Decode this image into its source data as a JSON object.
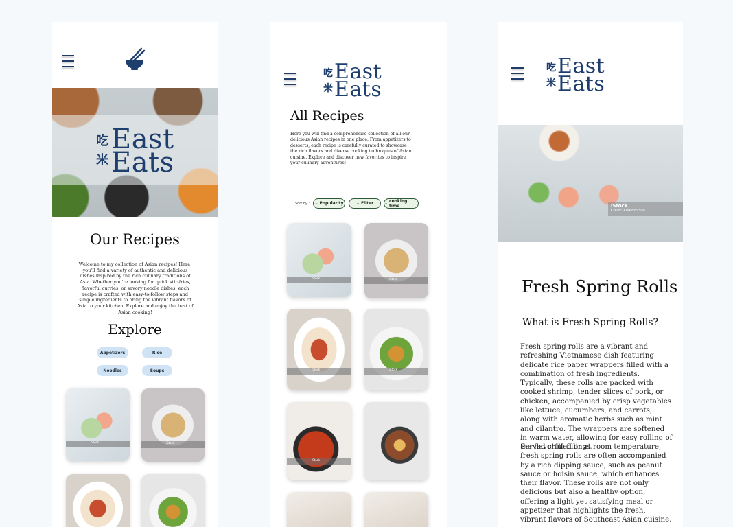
{
  "colors": {
    "brand_blue": "#1e3e6e",
    "chip_blue": "#cfe3f5",
    "sort_green_border": "#2f5a3a",
    "sort_green_bg": "#e9f4e6",
    "page_bg": "#f6f9fc"
  },
  "brand": {
    "name_line1": "East",
    "name_line2": "Eats",
    "char_top": "吃",
    "char_bottom": "米"
  },
  "screen1": {
    "title": "Our Recipes",
    "intro": "Welcome to my collection of Asian recipes! Here, you'll find a variety of authentic and delicious dishes inspired by the rich culinary traditions of Asia. Whether you're looking for quick stir-fries, flavorful curries, or savory noodle dishes, each recipe is crafted with easy-to-follow steps and simple ingredients to bring the vibrant flavors of Asia to your kitchen. Explore and enjoy the best of Asian cooking!",
    "explore_title": "Explore",
    "categories": [
      "Appetizers",
      "Rice",
      "Noodles",
      "Soups"
    ],
    "stock_label": "iStock"
  },
  "screen2": {
    "title": "All Recipes",
    "intro": "Here you will find a comprehensive collection of all our delicious Asian recipes in one place. From appetizers to desserts, each recipe is carefully curated to showcase the rich flavors and diverse cooking techniques of Asian cuisine. Explore and discover new favorites to inspire your culinary adventures!",
    "sort_label": "Sort by :",
    "sort_options": [
      "Popularity",
      "Filter",
      "cooking time"
    ],
    "stock_label": "iStock"
  },
  "screen3": {
    "photo_stock": "iStock",
    "photo_credit": "Credit: AlexPro9500",
    "title": "Fresh Spring Rolls",
    "subtitle": "What is Fresh Spring Rolls?",
    "para1": "Fresh spring rolls are a vibrant and refreshing Vietnamese dish featuring delicate rice paper wrappers filled with a combination of fresh ingredients. Typically, these rolls are packed with cooked shrimp, tender slices of pork, or chicken, accompanied by crisp vegetables like lettuce, cucumbers, and carrots, along with aromatic herbs such as mint and cilantro. The wrappers are softened in warm water, allowing for easy rolling of the flavorful fillings.",
    "para2": "Served chilled or at room temperature, fresh spring rolls are often accompanied by a rich dipping sauce, such as peanut sauce or hoisin sauce, which enhances their flavor. These rolls are not only delicious but also a healthy option, offering a light yet satisfying meal or appetizer that highlights the fresh, vibrant flavors of Southeast Asian cuisine."
  }
}
